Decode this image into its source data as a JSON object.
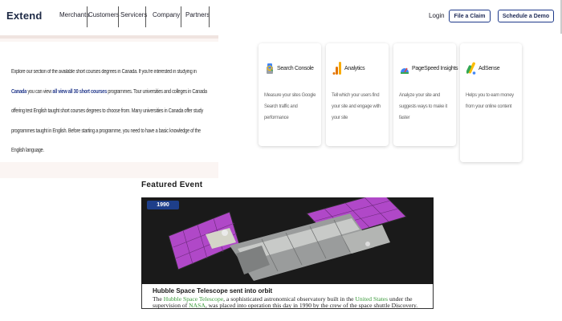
{
  "header": {
    "logo": "Extend",
    "nav": [
      "Merchants",
      "Customers",
      "Servicers",
      "Company",
      "Partners"
    ],
    "login": "Login",
    "claim_button": "File a Claim",
    "demo_button": "Schedule a Demo"
  },
  "info": {
    "p1": "Explore our section of the available short courses degrees in Canada. If you're interested in studying in ",
    "link1": "Canada",
    "p2": " you can view ",
    "link2": "all view all 30 short courses",
    "p3": " programmes. Tour universities and colleges in Canada offering test English taught short courses degrees to choose from. Many universities in Canada offer study programmes taught in English. Before starting a programme, you need to have a basic knowledge of the English language."
  },
  "tools": [
    {
      "name": "Search Console",
      "desc": "Measure your sites Google Search traffic and performance",
      "icon": "search-console-icon"
    },
    {
      "name": "Analytics",
      "desc": "Tell which your users find your site and engage with your site",
      "icon": "analytics-icon"
    },
    {
      "name": "PageSpeed Insights",
      "desc": "Analyze your site and suggests ways to make it faster",
      "icon": "pagespeed-icon"
    },
    {
      "name": "AdSense",
      "desc": "Helps you to earn money from your online content",
      "icon": "adsense-icon"
    }
  ],
  "featured": {
    "section_title": "Featured Event",
    "year_badge": "1990",
    "title": "Hubble Space Telescope sent into orbit",
    "text_prefix": "The ",
    "link_hubble": "Hubble Space Telescope",
    "text_mid1": ", a sophisticated astronomical observatory built in the ",
    "link_us": "United States",
    "text_mid2": " under the supervision of ",
    "link_nasa": "NASA",
    "text_suffix": ", was placed into operation this day in 1990 by the crew of the space shuttle Discovery."
  },
  "colors": {
    "accent": "#1e3a8a",
    "link_green": "#3a9a3a",
    "panel_bg": "#fbf5f3"
  }
}
